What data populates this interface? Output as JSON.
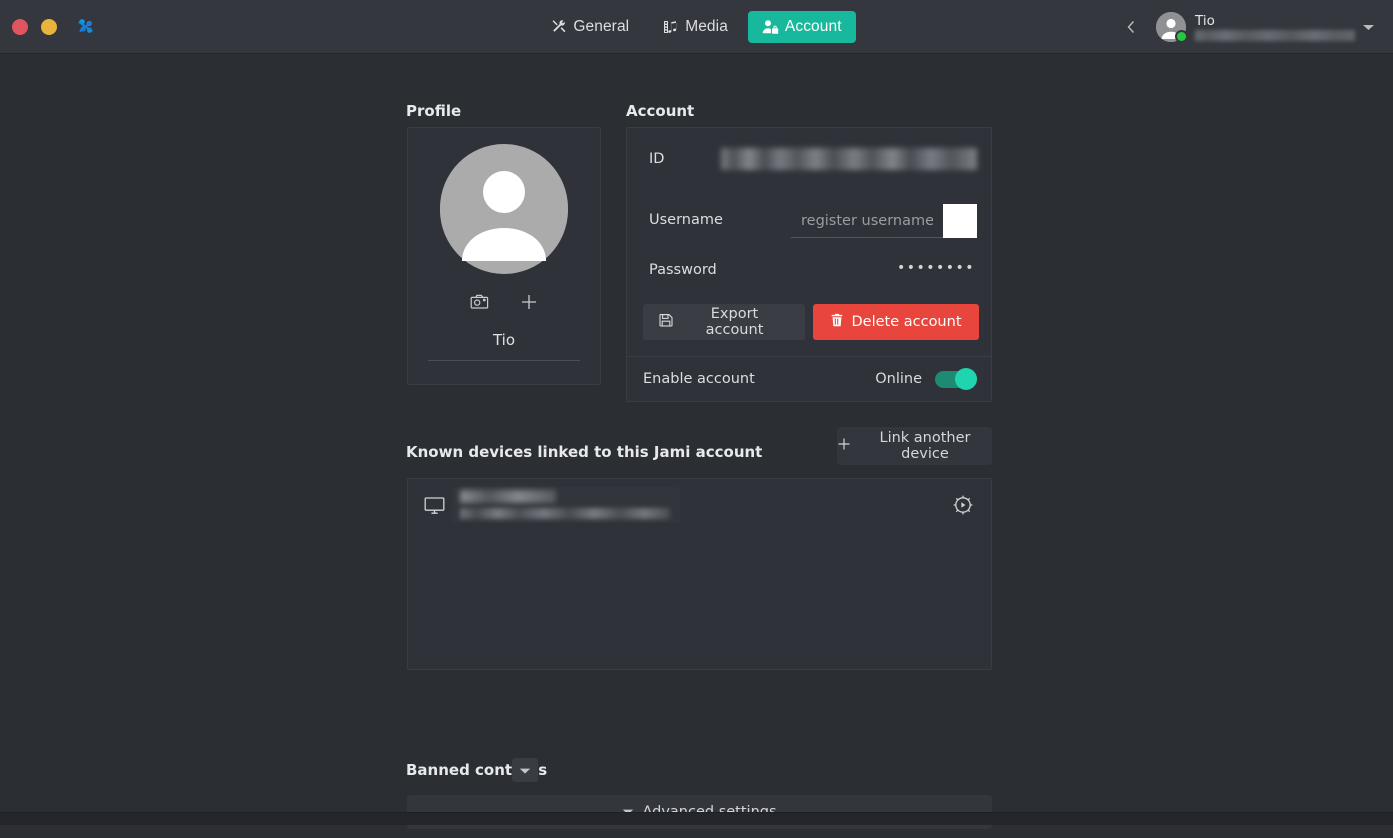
{
  "window": {
    "controls": {
      "close": "close-button",
      "minimize": "minimize-button"
    },
    "app_icon": "jami-logo-icon"
  },
  "tabs": [
    {
      "id": "general",
      "label": "General",
      "icon": "tools-icon",
      "active": false
    },
    {
      "id": "media",
      "label": "Media",
      "icon": "media-icon",
      "active": false
    },
    {
      "id": "account",
      "label": "Account",
      "icon": "account-lock-icon",
      "active": true
    }
  ],
  "account_selector": {
    "name": "Tio",
    "id_redacted": "████████████████████",
    "presence": "online",
    "presence_color": "#28c940",
    "back_icon": "chevron-left-icon",
    "dropdown_icon": "chevron-down-icon"
  },
  "profile": {
    "title": "Profile",
    "avatar": "default-avatar-icon",
    "camera_action": "camera-icon",
    "add_action": "plus-icon",
    "display_name": "Tio"
  },
  "account": {
    "title": "Account",
    "id_label": "ID",
    "id_value_redacted": "████████████████████████",
    "username_label": "Username",
    "username_value": "",
    "username_placeholder": "register username",
    "register_button_label": "",
    "password_label": "Password",
    "password_masked": "••••••••",
    "export_label": "Export account",
    "export_icon": "save-icon",
    "delete_label": "Delete account",
    "delete_icon": "trash-icon",
    "delete_color": "#e8453c",
    "enable_label": "Enable account",
    "status_label": "Online",
    "toggle_on": true,
    "toggle_color": "#1fd4ae"
  },
  "devices": {
    "title": "Known devices linked to this Jami account",
    "link_button_label": "Link another device",
    "link_button_icon": "plus-icon",
    "rows": [
      {
        "icon": "monitor-icon",
        "name_redacted": "███████",
        "id_redacted": "██████████████████████",
        "settings_icon": "gear-icon"
      }
    ]
  },
  "banned_contacts": {
    "title": "Banned contacts",
    "toggle_icon": "caret-down-icon"
  },
  "advanced": {
    "label": "Advanced settings",
    "icon": "caret-down-icon"
  }
}
